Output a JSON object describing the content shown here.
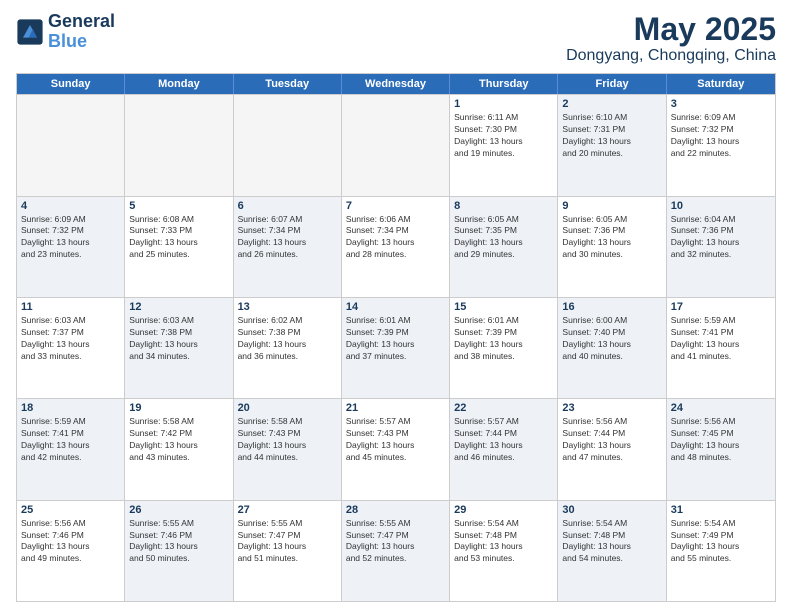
{
  "header": {
    "logo_line1": "General",
    "logo_line2": "Blue",
    "main_title": "May 2025",
    "subtitle": "Dongyang, Chongqing, China"
  },
  "calendar": {
    "days": [
      "Sunday",
      "Monday",
      "Tuesday",
      "Wednesday",
      "Thursday",
      "Friday",
      "Saturday"
    ],
    "rows": [
      [
        {
          "day": "",
          "empty": true
        },
        {
          "day": "",
          "empty": true
        },
        {
          "day": "",
          "empty": true
        },
        {
          "day": "",
          "empty": true
        },
        {
          "day": "1",
          "text": "Sunrise: 6:11 AM\nSunset: 7:30 PM\nDaylight: 13 hours\nand 19 minutes."
        },
        {
          "day": "2",
          "text": "Sunrise: 6:10 AM\nSunset: 7:31 PM\nDaylight: 13 hours\nand 20 minutes.",
          "shaded": true
        },
        {
          "day": "3",
          "text": "Sunrise: 6:09 AM\nSunset: 7:32 PM\nDaylight: 13 hours\nand 22 minutes."
        }
      ],
      [
        {
          "day": "4",
          "text": "Sunrise: 6:09 AM\nSunset: 7:32 PM\nDaylight: 13 hours\nand 23 minutes.",
          "shaded": true
        },
        {
          "day": "5",
          "text": "Sunrise: 6:08 AM\nSunset: 7:33 PM\nDaylight: 13 hours\nand 25 minutes."
        },
        {
          "day": "6",
          "text": "Sunrise: 6:07 AM\nSunset: 7:34 PM\nDaylight: 13 hours\nand 26 minutes.",
          "shaded": true
        },
        {
          "day": "7",
          "text": "Sunrise: 6:06 AM\nSunset: 7:34 PM\nDaylight: 13 hours\nand 28 minutes."
        },
        {
          "day": "8",
          "text": "Sunrise: 6:05 AM\nSunset: 7:35 PM\nDaylight: 13 hours\nand 29 minutes.",
          "shaded": true
        },
        {
          "day": "9",
          "text": "Sunrise: 6:05 AM\nSunset: 7:36 PM\nDaylight: 13 hours\nand 30 minutes."
        },
        {
          "day": "10",
          "text": "Sunrise: 6:04 AM\nSunset: 7:36 PM\nDaylight: 13 hours\nand 32 minutes.",
          "shaded": true
        }
      ],
      [
        {
          "day": "11",
          "text": "Sunrise: 6:03 AM\nSunset: 7:37 PM\nDaylight: 13 hours\nand 33 minutes."
        },
        {
          "day": "12",
          "text": "Sunrise: 6:03 AM\nSunset: 7:38 PM\nDaylight: 13 hours\nand 34 minutes.",
          "shaded": true
        },
        {
          "day": "13",
          "text": "Sunrise: 6:02 AM\nSunset: 7:38 PM\nDaylight: 13 hours\nand 36 minutes."
        },
        {
          "day": "14",
          "text": "Sunrise: 6:01 AM\nSunset: 7:39 PM\nDaylight: 13 hours\nand 37 minutes.",
          "shaded": true
        },
        {
          "day": "15",
          "text": "Sunrise: 6:01 AM\nSunset: 7:39 PM\nDaylight: 13 hours\nand 38 minutes."
        },
        {
          "day": "16",
          "text": "Sunrise: 6:00 AM\nSunset: 7:40 PM\nDaylight: 13 hours\nand 40 minutes.",
          "shaded": true
        },
        {
          "day": "17",
          "text": "Sunrise: 5:59 AM\nSunset: 7:41 PM\nDaylight: 13 hours\nand 41 minutes."
        }
      ],
      [
        {
          "day": "18",
          "text": "Sunrise: 5:59 AM\nSunset: 7:41 PM\nDaylight: 13 hours\nand 42 minutes.",
          "shaded": true
        },
        {
          "day": "19",
          "text": "Sunrise: 5:58 AM\nSunset: 7:42 PM\nDaylight: 13 hours\nand 43 minutes."
        },
        {
          "day": "20",
          "text": "Sunrise: 5:58 AM\nSunset: 7:43 PM\nDaylight: 13 hours\nand 44 minutes.",
          "shaded": true
        },
        {
          "day": "21",
          "text": "Sunrise: 5:57 AM\nSunset: 7:43 PM\nDaylight: 13 hours\nand 45 minutes."
        },
        {
          "day": "22",
          "text": "Sunrise: 5:57 AM\nSunset: 7:44 PM\nDaylight: 13 hours\nand 46 minutes.",
          "shaded": true
        },
        {
          "day": "23",
          "text": "Sunrise: 5:56 AM\nSunset: 7:44 PM\nDaylight: 13 hours\nand 47 minutes."
        },
        {
          "day": "24",
          "text": "Sunrise: 5:56 AM\nSunset: 7:45 PM\nDaylight: 13 hours\nand 48 minutes.",
          "shaded": true
        }
      ],
      [
        {
          "day": "25",
          "text": "Sunrise: 5:56 AM\nSunset: 7:46 PM\nDaylight: 13 hours\nand 49 minutes."
        },
        {
          "day": "26",
          "text": "Sunrise: 5:55 AM\nSunset: 7:46 PM\nDaylight: 13 hours\nand 50 minutes.",
          "shaded": true
        },
        {
          "day": "27",
          "text": "Sunrise: 5:55 AM\nSunset: 7:47 PM\nDaylight: 13 hours\nand 51 minutes."
        },
        {
          "day": "28",
          "text": "Sunrise: 5:55 AM\nSunset: 7:47 PM\nDaylight: 13 hours\nand 52 minutes.",
          "shaded": true
        },
        {
          "day": "29",
          "text": "Sunrise: 5:54 AM\nSunset: 7:48 PM\nDaylight: 13 hours\nand 53 minutes."
        },
        {
          "day": "30",
          "text": "Sunrise: 5:54 AM\nSunset: 7:48 PM\nDaylight: 13 hours\nand 54 minutes.",
          "shaded": true
        },
        {
          "day": "31",
          "text": "Sunrise: 5:54 AM\nSunset: 7:49 PM\nDaylight: 13 hours\nand 55 minutes."
        }
      ]
    ]
  }
}
